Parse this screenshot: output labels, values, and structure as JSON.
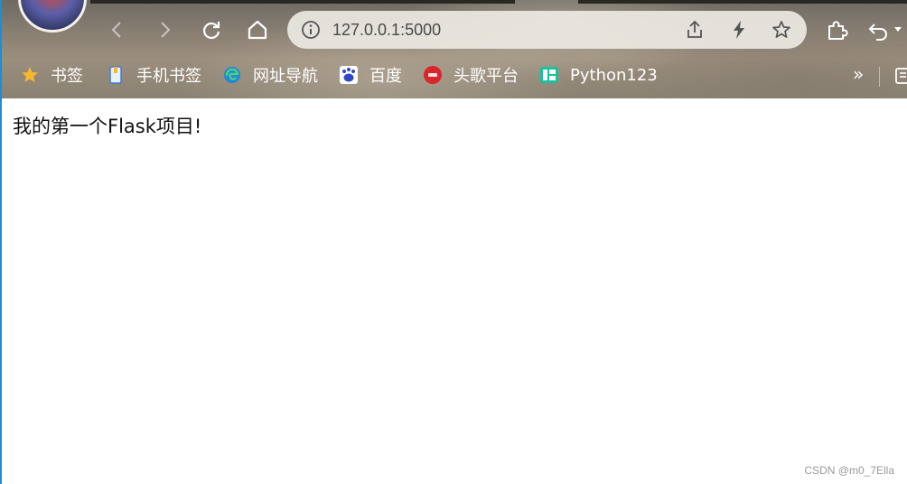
{
  "browser": {
    "address_bar": {
      "url": "127.0.0.1:5000"
    },
    "bookmarks": [
      {
        "label": "书签",
        "icon": "star-icon"
      },
      {
        "label": "手机书签",
        "icon": "phone-icon"
      },
      {
        "label": "网址导航",
        "icon": "edge-icon"
      },
      {
        "label": "百度",
        "icon": "baidu-icon"
      },
      {
        "label": "头歌平台",
        "icon": "touge-icon"
      },
      {
        "label": "Python123",
        "icon": "python123-icon"
      }
    ],
    "overflow_label": "»"
  },
  "page": {
    "text": "我的第一个Flask项目!",
    "watermark": "CSDN @m0_7Ella"
  },
  "colors": {
    "accent": "#1a8fd6",
    "address_bar_bg": "#ece9e3",
    "bookmark_text": "#ffffff",
    "page_text": "#111111"
  }
}
